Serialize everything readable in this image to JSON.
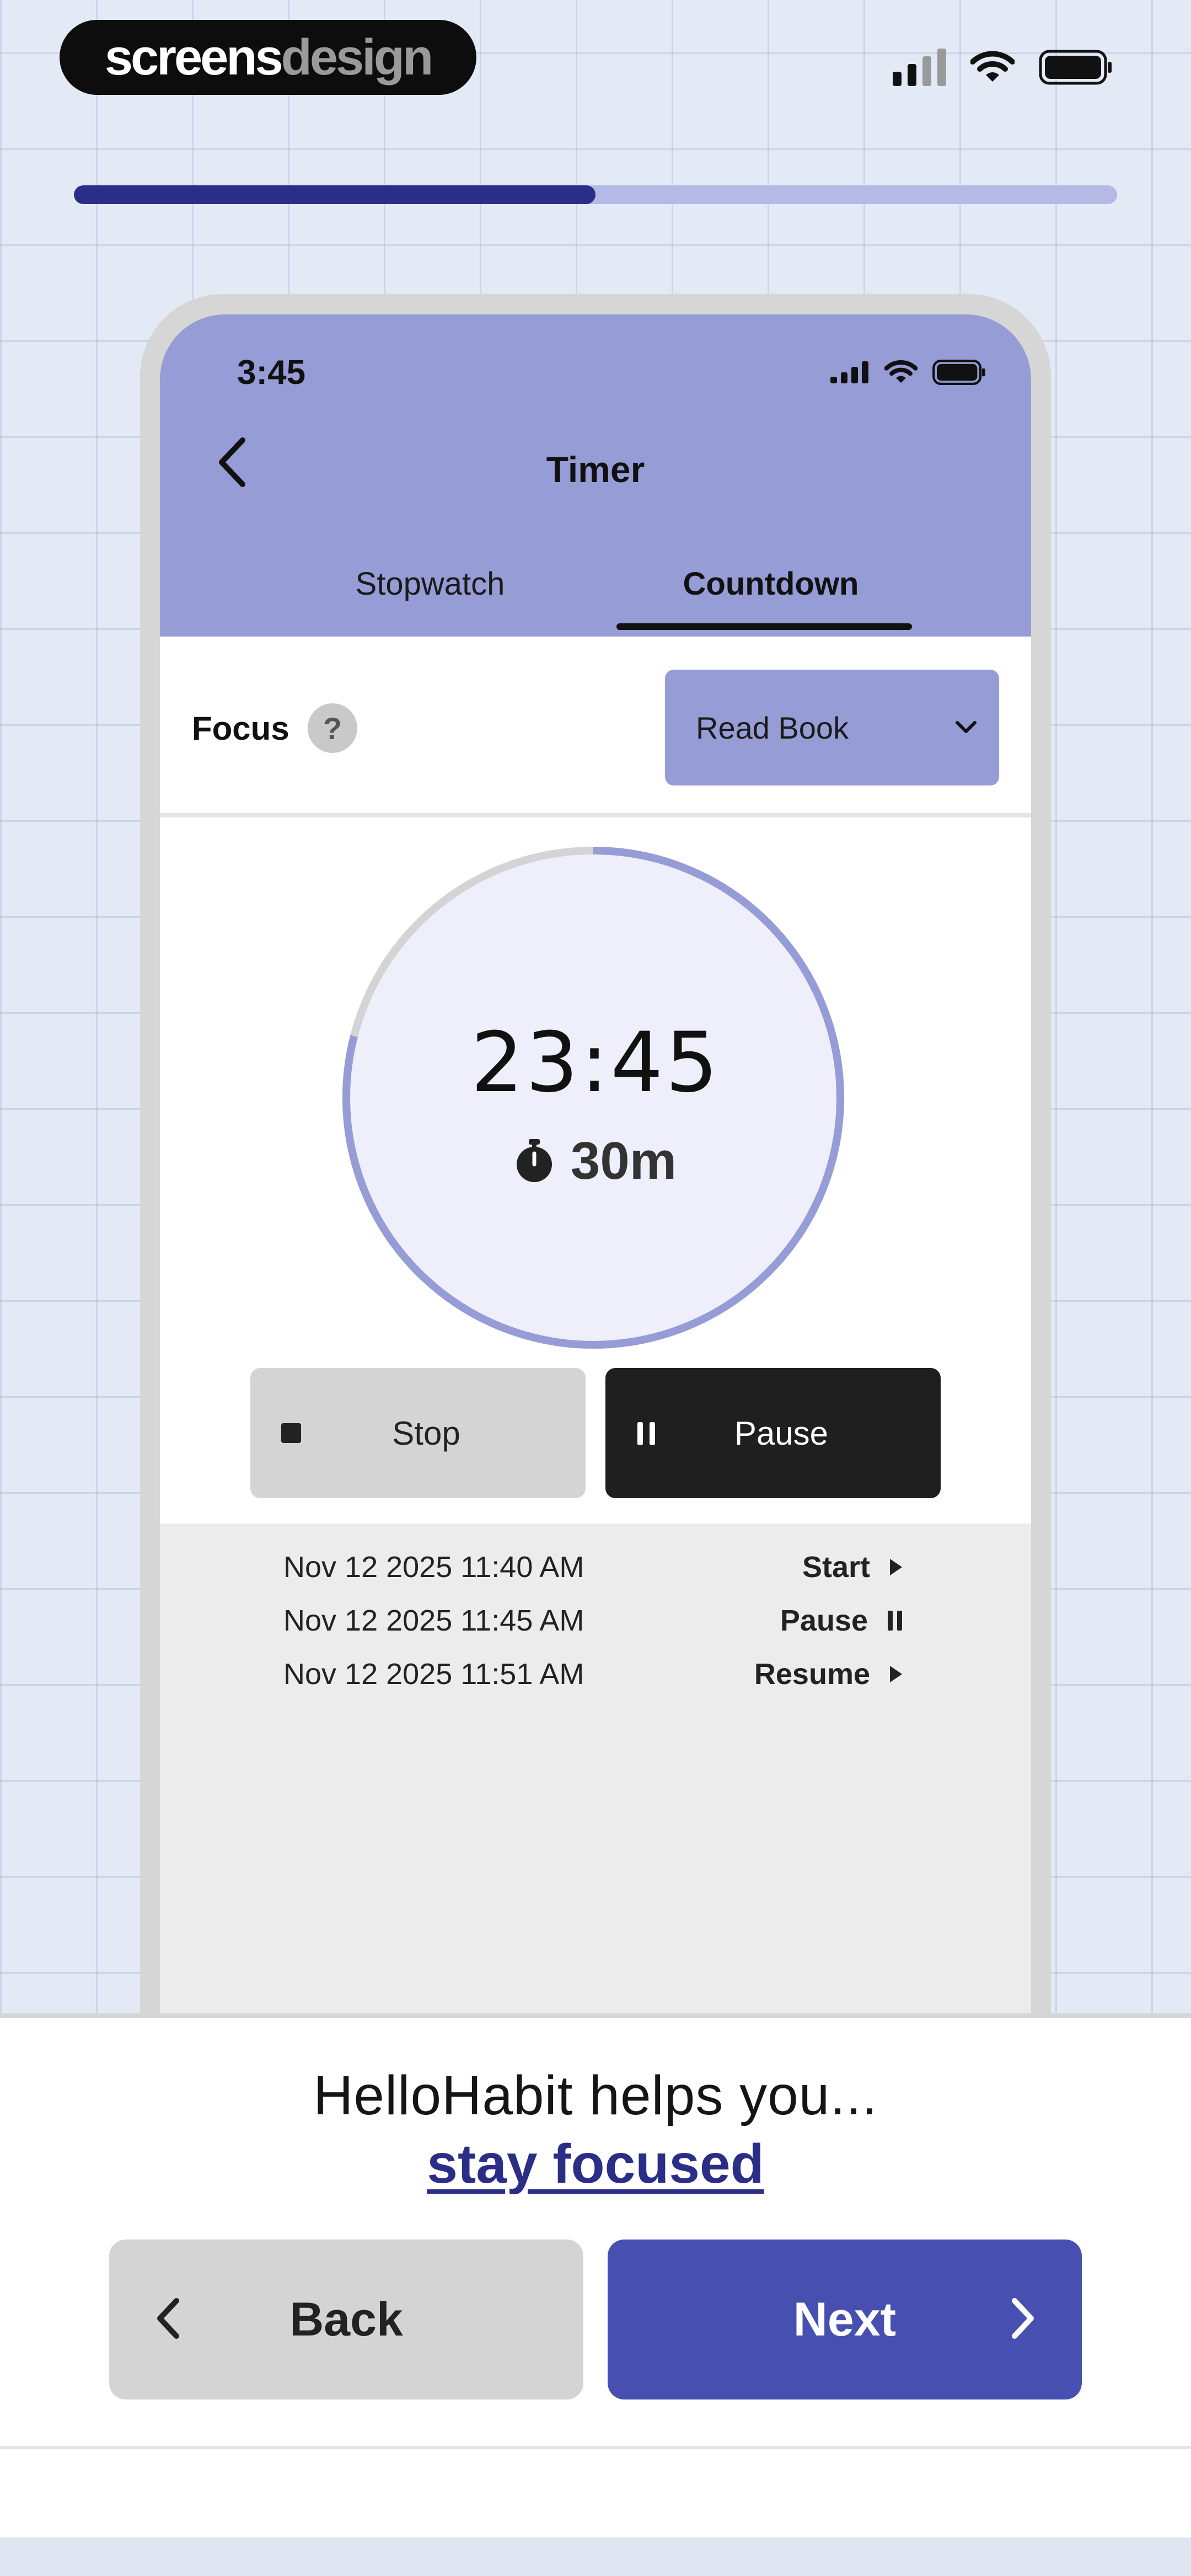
{
  "brand": {
    "part1": "screens",
    "part2": "design"
  },
  "onboarding": {
    "progress": 0.5
  },
  "app": {
    "status_time": "3:45",
    "title": "Timer",
    "tabs": [
      {
        "label": "Stopwatch",
        "active": false
      },
      {
        "label": "Countdown",
        "active": true
      }
    ],
    "focus_label": "Focus",
    "help_symbol": "?",
    "activity_select": "Read Book",
    "timer": {
      "remaining": "23:45",
      "duration": "30m",
      "elapsed_fraction": 0.21
    },
    "stop_label": "Stop",
    "pause_label": "Pause",
    "log": [
      {
        "date": "Nov 12 2025 11:40 AM",
        "action": "Start",
        "icon": "play-icon"
      },
      {
        "date": "Nov 12 2025 11:45 AM",
        "action": "Pause",
        "icon": "pause-icon"
      },
      {
        "date": "Nov 12 2025 11:51 AM",
        "action": "Resume",
        "icon": "play-icon"
      }
    ]
  },
  "panel": {
    "headline": "HelloHabit helps you...",
    "highlight": "stay focused",
    "back_label": "Back",
    "next_label": "Next"
  },
  "colors": {
    "accent": "#969cd5",
    "primary": "#4750b1",
    "progress_fill": "#2b2e87",
    "progress_track": "#b4b9e6"
  }
}
